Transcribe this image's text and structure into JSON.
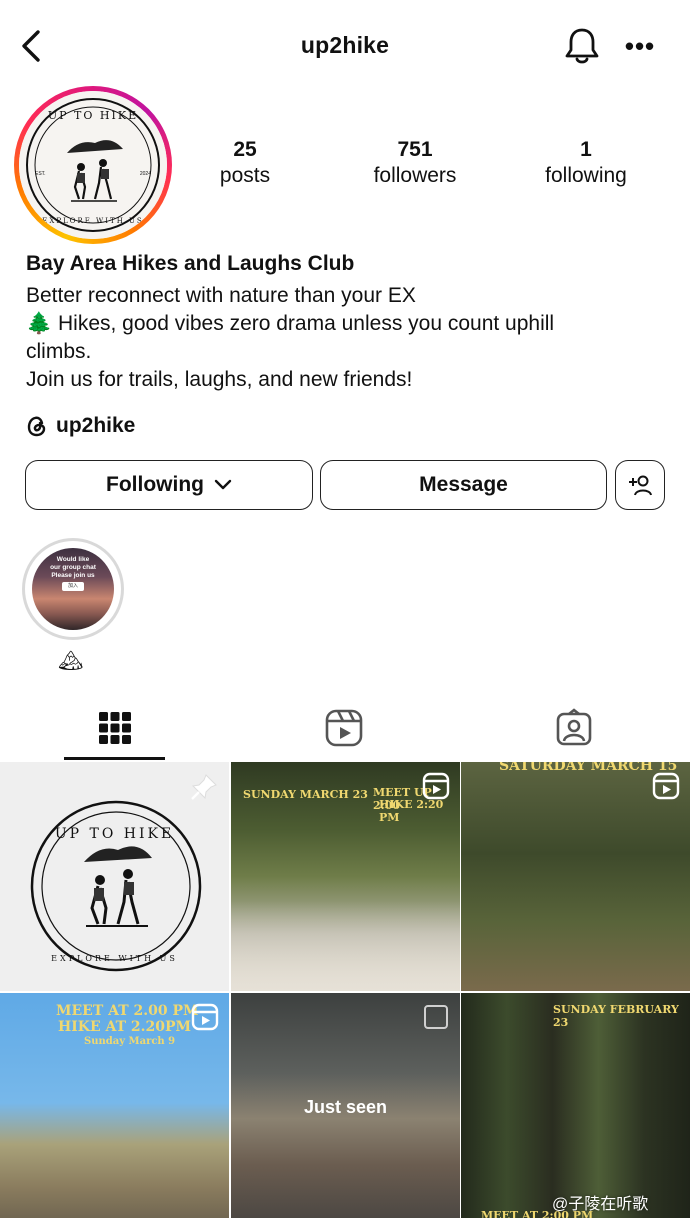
{
  "header": {
    "username": "up2hike",
    "more_label": "•••"
  },
  "avatar": {
    "logo_text_top": "UP TO HIKE",
    "logo_text_bottom": "EXPLORE WITH US",
    "est_left": "EST.",
    "est_right": "2024"
  },
  "stats": [
    {
      "value": "25",
      "label": "posts"
    },
    {
      "value": "751",
      "label": "followers"
    },
    {
      "value": "1",
      "label": "following"
    }
  ],
  "bio": {
    "name": "Bay Area Hikes and Laughs Club",
    "line1": "Better reconnect with nature than your EX",
    "line2": "🌲 Hikes, good vibes zero drama unless you count uphill",
    "line3": "climbs.",
    "line4": "Join us for trails, laughs, and new friends!"
  },
  "threads": {
    "handle": "up2hike"
  },
  "actions": {
    "following_label": "Following",
    "message_label": "Message"
  },
  "highlights": [
    {
      "title": "🏔",
      "cover_text_1": "Would like",
      "cover_text_2": "our group chat",
      "cover_text_3": "Please join us",
      "chip": "加入"
    }
  ],
  "posts": [
    {
      "type": "pinned"
    },
    {
      "type": "reel",
      "caption_left": "SUNDAY MARCH 23",
      "caption_right_1": "MEET UP 2:00",
      "caption_right_2": "HIKE 2:20 PM"
    },
    {
      "type": "reel",
      "caption_top": "SATURDAY MARCH 15"
    },
    {
      "type": "reel",
      "caption_1": "MEET AT 2.00 PM",
      "caption_2": "HIKE AT 2.20PM",
      "caption_3": "Sunday March 9"
    },
    {
      "type": "seen",
      "overlay": "Just seen"
    },
    {
      "type": "photo",
      "caption_top": "SUNDAY FEBRUARY 23",
      "caption_bottom": "MEET AT 2:00 PM"
    }
  ],
  "watermark": "@子陵在听歌"
}
